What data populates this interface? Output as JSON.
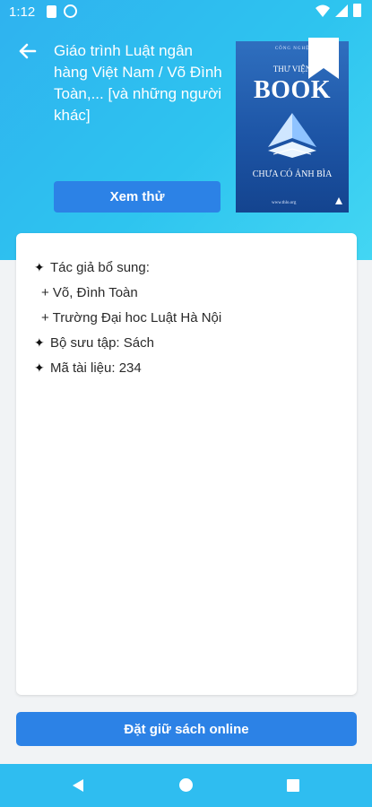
{
  "status_bar": {
    "time": "1:12",
    "icons": [
      "sd-card-icon",
      "sync-icon",
      "wifi-icon",
      "signal-icon",
      "battery-icon"
    ]
  },
  "header": {
    "title": "Giáo trình Luật ngân hàng Việt Nam / Võ Đình Toàn,... [và những người khác]",
    "preview_label": "Xem thử",
    "back_icon": "arrow-left-icon",
    "bookmark_icon": "bookmark-icon"
  },
  "cover": {
    "publisher": "CÔNG NGHỆ",
    "subtitle": "THƯ VIỆN",
    "title": "BOOK",
    "caption": "CHƯA CÓ ẢNH BÌA",
    "url": "www.thlo.org"
  },
  "details": {
    "authors_label": "Tác giả bổ sung:",
    "authors": [
      "+ Võ, Đình Toàn",
      "+ Trường Đại hoc Luật Hà Nội"
    ],
    "collection": "Bộ sưu tập: Sách",
    "doc_id": "Mã tài liệu: 234"
  },
  "actions": {
    "reserve_label": "Đặt giữ sách online"
  },
  "colors": {
    "header_gradient_start": "#2fb2ef",
    "header_gradient_end": "#43d6f3",
    "primary_button": "#2c82e6",
    "nav_bar": "#2fbdf0"
  }
}
